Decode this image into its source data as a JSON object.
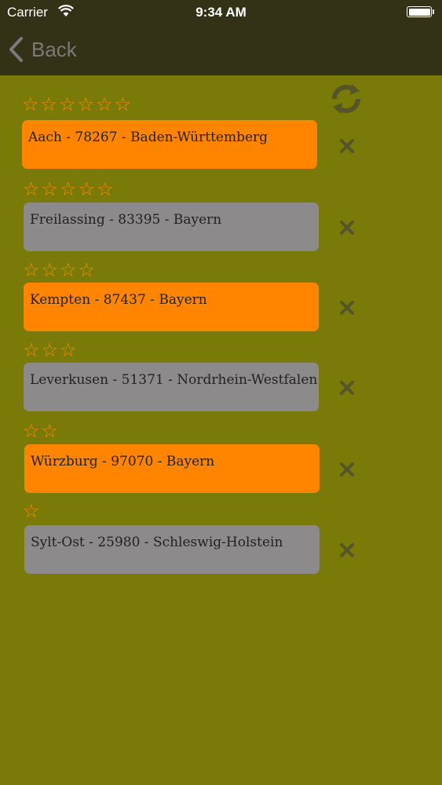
{
  "status_bar": {
    "carrier": "Carrier",
    "time": "9:34 AM"
  },
  "nav": {
    "back_label": "Back"
  },
  "colors": {
    "background": "#7a7a08",
    "header": "#333216",
    "orange_card": "#ff8400",
    "gray_card": "#8c8a8a",
    "star": "#ff8800",
    "icon": "#55552a"
  },
  "list": [
    {
      "rating": 6,
      "stars": "☆☆☆☆☆☆",
      "text": "Aach - 78267 - Baden-Württemberg",
      "style": "orange"
    },
    {
      "rating": 5,
      "stars": "☆☆☆☆☆",
      "text": "Freilassing - 83395 - Bayern",
      "style": "gray"
    },
    {
      "rating": 4,
      "stars": "☆☆☆☆",
      "text": "Kempten - 87437 - Bayern",
      "style": "orange"
    },
    {
      "rating": 3,
      "stars": "☆☆☆",
      "text": "Leverkusen - 51371 - Nordrhein-Westfalen",
      "style": "gray"
    },
    {
      "rating": 2,
      "stars": "☆☆",
      "text": "Würzburg - 97070 - Bayern",
      "style": "orange"
    },
    {
      "rating": 1,
      "stars": "☆",
      "text": "Sylt-Ost - 25980 - Schleswig-Holstein",
      "style": "gray"
    }
  ]
}
